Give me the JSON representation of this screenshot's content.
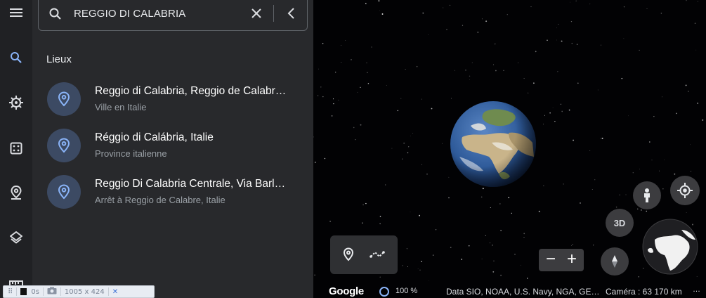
{
  "search": {
    "query": "REGGIO DI CALABRIA"
  },
  "results": {
    "section_title": "Lieux",
    "items": [
      {
        "title": "Reggio di Calabria, Reggio de Calabr…",
        "subtitle": "Ville en Italie"
      },
      {
        "title": "Réggio di Calábria, Italie",
        "subtitle": "Province italienne"
      },
      {
        "title": "Reggio Di Calabria Centrale, Via Barl…",
        "subtitle": "Arrêt à Reggio de Calabre, Italie"
      }
    ]
  },
  "rail": {
    "icons": [
      "menu-icon",
      "search-icon",
      "voyager-icon",
      "feeling-lucky-icon",
      "projects-icon",
      "layers-icon",
      "measure-icon"
    ]
  },
  "map": {
    "button_3d": "3D",
    "zoom_out": "−",
    "zoom_in": "+"
  },
  "bottom": {
    "logo": "Google",
    "progress_label": "100 %",
    "attribution": "Data SIO, NOAA, U.S. Navy, NGA, GE…",
    "camera": "Caméra : 63 170 km",
    "more": "…"
  },
  "devtools": {
    "time": "0s",
    "size": "1005 x 424"
  },
  "colors": {
    "rail_bg": "#202124",
    "panel_bg": "#28292c",
    "pin_circle": "#3c4a63",
    "accent_blue": "#8ab4f8"
  }
}
